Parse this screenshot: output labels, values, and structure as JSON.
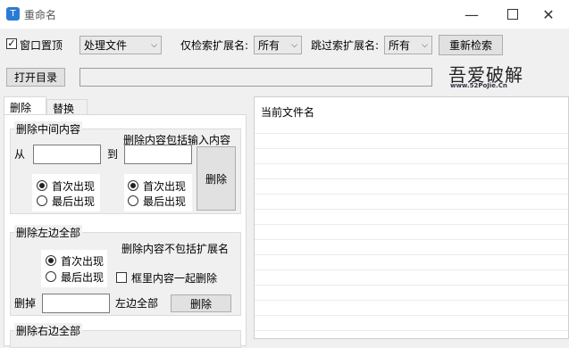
{
  "window": {
    "title": "重命名"
  },
  "toolbar": {
    "topmost_label": "窗口置顶",
    "topmost_checked": true,
    "mode_select": "处理文件",
    "only_ext_label": "仅检索扩展名:",
    "only_ext_value": "所有",
    "skip_ext_label": "跳过索扩展名:",
    "skip_ext_value": "所有",
    "research_button": "重新检索",
    "open_dir_button": "打开目录",
    "path_value": "",
    "logo_text": "吾爱破解",
    "logo_url": "www.52PoJie.Cn"
  },
  "tabs": [
    "删除",
    "替换"
  ],
  "delete_middle": {
    "title": "删除中间内容",
    "include_label": "删除内容包括输入内容",
    "from_label": "从",
    "to_label": "到",
    "radio_first": "首次出现",
    "radio_last": "最后出现",
    "delete_button": "删除"
  },
  "delete_left": {
    "title": "删除左边全部",
    "exclude_ext_label": "删除内容不包括扩展名",
    "radio_first": "首次出现",
    "radio_last": "最后出现",
    "inner_checkbox_label": "框里内容一起删除",
    "remove_label": "删掉",
    "left_all_label": "左边全部",
    "delete_button": "删除"
  },
  "delete_right": {
    "title": "删除右边全部"
  },
  "file_list": {
    "header": "当前文件名"
  }
}
